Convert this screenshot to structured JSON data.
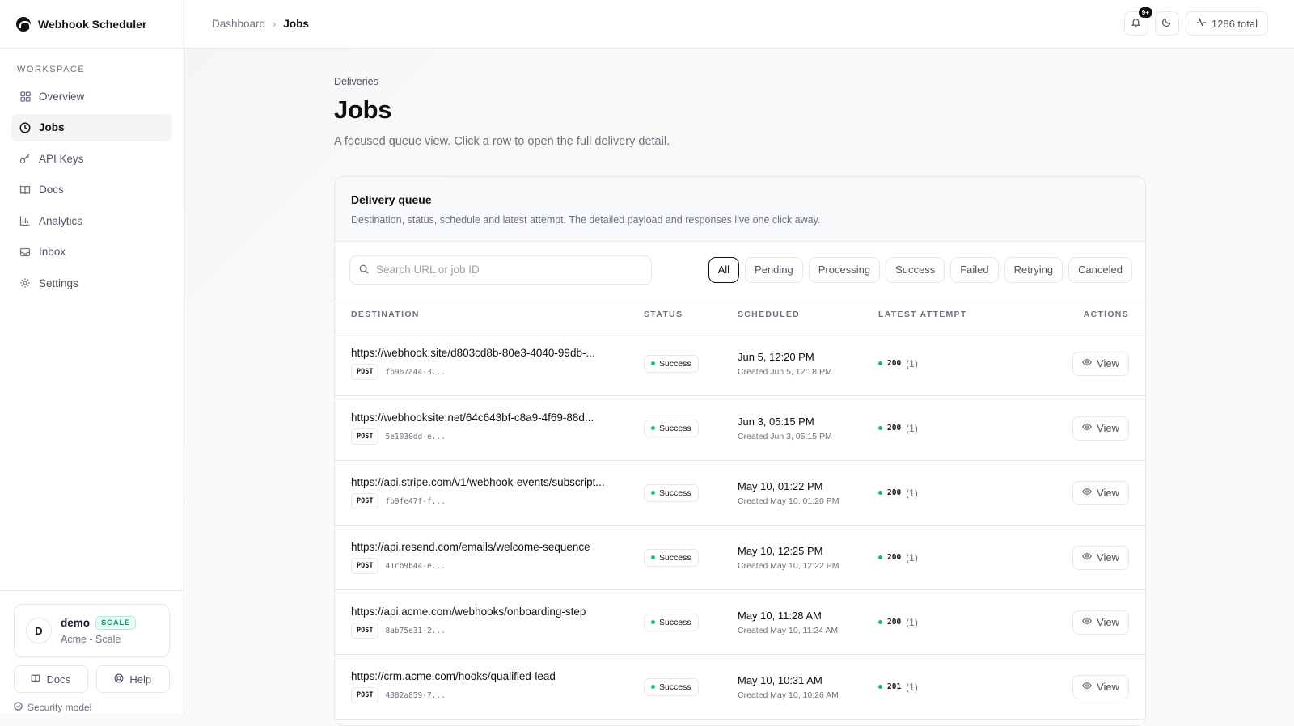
{
  "app": {
    "name": "Webhook Scheduler"
  },
  "sidebar": {
    "section_label": "WORKSPACE",
    "items": [
      {
        "label": "Overview",
        "icon": "grid-icon"
      },
      {
        "label": "Jobs",
        "icon": "clock-icon",
        "active": true
      },
      {
        "label": "API Keys",
        "icon": "key-icon"
      },
      {
        "label": "Docs",
        "icon": "book-icon"
      },
      {
        "label": "Analytics",
        "icon": "bar-chart-icon"
      },
      {
        "label": "Inbox",
        "icon": "inbox-icon"
      },
      {
        "label": "Settings",
        "icon": "gear-icon"
      }
    ],
    "user": {
      "initial": "D",
      "name": "demo",
      "plan": "SCALE",
      "org": "Acme - Scale"
    },
    "docs_label": "Docs",
    "help_label": "Help",
    "security_label": "Security model"
  },
  "header": {
    "breadcrumb": [
      "Dashboard",
      "Jobs"
    ],
    "notif_count": "9+",
    "total_label": "1286 total"
  },
  "page": {
    "eyebrow": "Deliveries",
    "title": "Jobs",
    "subtitle": "A focused queue view. Click a row to open the full delivery detail."
  },
  "queue": {
    "title": "Delivery queue",
    "description": "Destination, status, schedule and latest attempt. The detailed payload and responses live one click away.",
    "search_placeholder": "Search URL or job ID",
    "filters": [
      "All",
      "Pending",
      "Processing",
      "Success",
      "Failed",
      "Retrying",
      "Canceled"
    ],
    "active_filter": "All",
    "columns": [
      "DESTINATION",
      "STATUS",
      "SCHEDULED",
      "LATEST ATTEMPT",
      "ACTIONS"
    ],
    "view_label": "View",
    "rows": [
      {
        "url": "https://webhook.site/d803cd8b-80e3-4040-99db-...",
        "method": "POST",
        "job_id": "fb967a44-3...",
        "status": "Success",
        "scheduled": "Jun 5, 12:20 PM",
        "created": "Created Jun 5, 12:18 PM",
        "code": "200",
        "attempts": "(1)"
      },
      {
        "url": "https://webhooksite.net/64c643bf-c8a9-4f69-88d...",
        "method": "POST",
        "job_id": "5e1030dd-e...",
        "status": "Success",
        "scheduled": "Jun 3, 05:15 PM",
        "created": "Created Jun 3, 05:15 PM",
        "code": "200",
        "attempts": "(1)"
      },
      {
        "url": "https://api.stripe.com/v1/webhook-events/subscript...",
        "method": "POST",
        "job_id": "fb9fe47f-f...",
        "status": "Success",
        "scheduled": "May 10, 01:22 PM",
        "created": "Created May 10, 01:20 PM",
        "code": "200",
        "attempts": "(1)"
      },
      {
        "url": "https://api.resend.com/emails/welcome-sequence",
        "method": "POST",
        "job_id": "41cb9b44-e...",
        "status": "Success",
        "scheduled": "May 10, 12:25 PM",
        "created": "Created May 10, 12:22 PM",
        "code": "200",
        "attempts": "(1)"
      },
      {
        "url": "https://api.acme.com/webhooks/onboarding-step",
        "method": "POST",
        "job_id": "8ab75e31-2...",
        "status": "Success",
        "scheduled": "May 10, 11:28 AM",
        "created": "Created May 10, 11:24 AM",
        "code": "200",
        "attempts": "(1)"
      },
      {
        "url": "https://crm.acme.com/hooks/qualified-lead",
        "method": "POST",
        "job_id": "4382a859-7...",
        "status": "Success",
        "scheduled": "May 10, 10:31 AM",
        "created": "Created May 10, 10:26 AM",
        "code": "201",
        "attempts": "(1)"
      }
    ]
  }
}
